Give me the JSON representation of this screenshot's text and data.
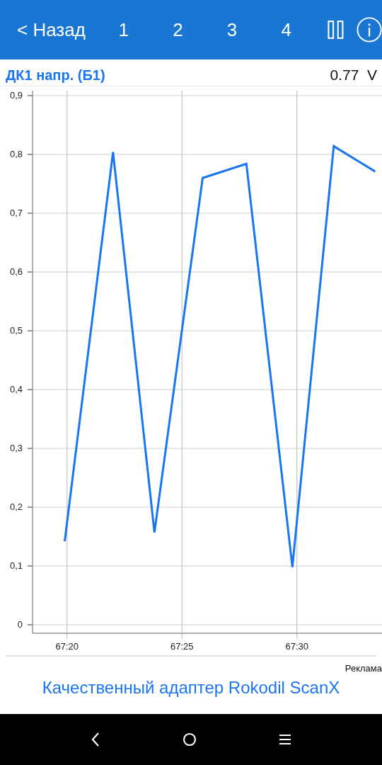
{
  "header": {
    "back": "< Назад",
    "tabs": [
      "1",
      "2",
      "3",
      "4"
    ]
  },
  "sensor": {
    "name": "ДК1 напр. (Б1)",
    "reading": "0.77  V",
    "chart_data": {
      "type": "line",
      "x": [
        4039.9,
        4042.0,
        4043.8,
        4045.9,
        4047.8,
        4049.8,
        4051.6,
        4053.4
      ],
      "grid": true,
      "series": [
        {
          "color": "#1a75f0",
          "values": [
            0.142,
            0.804,
            0.157,
            0.76,
            0.784,
            0.098,
            0.814,
            0.771
          ]
        }
      ],
      "xlim": [
        4038.5,
        4053.7
      ],
      "ylim": [
        0,
        0.9
      ],
      "xticks": [
        {
          "value": 4040,
          "label": "67:20"
        },
        {
          "value": 4045,
          "label": "67:25"
        },
        {
          "value": 4050,
          "label": "67:30"
        }
      ],
      "yticks": [
        {
          "value": 0,
          "label": "0"
        },
        {
          "value": 0.1,
          "label": "0,1"
        },
        {
          "value": 0.2,
          "label": "0,2"
        },
        {
          "value": 0.3,
          "label": "0,3"
        },
        {
          "value": 0.4,
          "label": "0,4"
        },
        {
          "value": 0.5,
          "label": "0,5"
        },
        {
          "value": 0.6,
          "label": "0,6"
        },
        {
          "value": 0.7,
          "label": "0,7"
        },
        {
          "value": 0.8,
          "label": "0,8"
        },
        {
          "value": 0.9,
          "label": "0,9"
        }
      ]
    }
  },
  "ad": {
    "label": "Реклама",
    "link": "Качественный адаптер Rokodil ScanX"
  }
}
